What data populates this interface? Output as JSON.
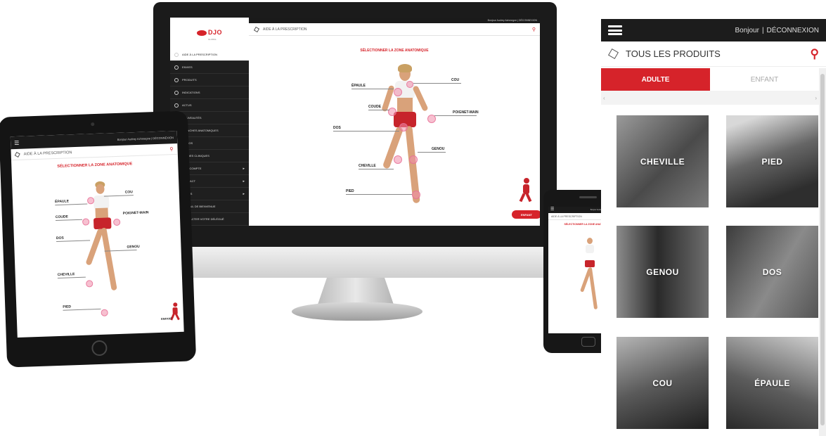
{
  "desktop": {
    "logo": "DJO",
    "logo_sub": "GLOBAL",
    "greeting": "Bonjour Audrey Azhmegne | DÉCONNEXION",
    "search_label": "AIDE À LA PRESCRIPTION",
    "title": "SÉLECTIONNER LA ZONE ANATOMIQUE",
    "sidebar": [
      {
        "label": "AIDE À LA PRESCRIPTION",
        "active": true
      },
      {
        "label": "ENVIES"
      },
      {
        "label": "PRODUITS"
      },
      {
        "label": "INDICATIONS"
      },
      {
        "label": "ACTUS"
      },
      {
        "label": "NOUVEAUTÉS"
      },
      {
        "label": "PLANCHES ANATOMIQUES"
      },
      {
        "label": "VIDÉOS"
      },
      {
        "label": "ÉTUDES CLINIQUES"
      },
      {
        "label": "MON COMPTE",
        "arrow": true
      },
      {
        "label": "CONTACT",
        "arrow": true
      },
      {
        "label": "OUTILS",
        "arrow": true
      },
      {
        "label": "PORTAIL DE BIENVENUE"
      },
      {
        "label": "CONTACTER VOTRE DÉLÉGUÉ"
      }
    ],
    "labels": {
      "epaule": "ÉPAULE",
      "cou": "COU",
      "coude": "COUDE",
      "poignet": "POIGNET-MAIN",
      "dos": "DOS",
      "genou": "GENOU",
      "cheville": "CHEVILLE",
      "pied": "PIED"
    },
    "enfant_button": "ENFANT"
  },
  "tablet": {
    "greeting": "Bonjour Audrey Azhmegne | DÉCONNEXION",
    "search_label": "AIDE À LA PRESCRIPTION",
    "title": "SÉLECTIONNER LA ZONE ANATOMIQUE",
    "labels": {
      "epaule": "ÉPAULE",
      "cou": "COU",
      "coude": "COUDE",
      "poignet": "POIGNET-MAIN",
      "dos": "DOS",
      "genou": "GENOU",
      "cheville": "CHEVILLE",
      "pied": "PIED"
    },
    "enfant": "ENFANT"
  },
  "phone": {
    "greeting": "Bonjour Audrey Azhmegne | DÉCONNEXION",
    "search_label": "AIDE À LA PRESCRIPTION",
    "title": "SÉLECTIONNER LA ZONE ANATOMIQUE"
  },
  "panel": {
    "greeting": "Bonjour",
    "separator": "|",
    "logout": "DÉCONNEXION",
    "search_label": "TOUS LES PRODUITS",
    "tabs": [
      {
        "label": "ADULTE",
        "active": true
      },
      {
        "label": "ENFANT",
        "active": false
      }
    ],
    "tiles": [
      {
        "label": "CHEVILLE"
      },
      {
        "label": "PIED"
      },
      {
        "label": "GENOU"
      },
      {
        "label": "DOS"
      },
      {
        "label": "COU"
      },
      {
        "label": "ÉPAULE"
      }
    ],
    "scroll_left": "‹",
    "scroll_right": "›"
  },
  "colors": {
    "accent": "#d6232a",
    "dark": "#1c1c1c"
  }
}
